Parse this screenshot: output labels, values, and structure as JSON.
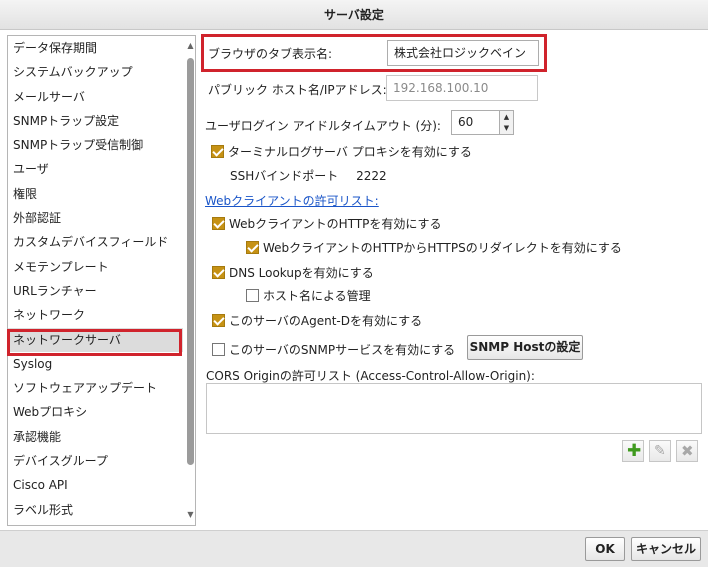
{
  "window": {
    "title": "サーバ設定"
  },
  "sidebar": {
    "items": [
      {
        "label": "データ保存期間"
      },
      {
        "label": "システムバックアップ"
      },
      {
        "label": "メールサーバ"
      },
      {
        "label": "SNMPトラップ設定"
      },
      {
        "label": "SNMPトラップ受信制御"
      },
      {
        "label": "ユーザ"
      },
      {
        "label": "権限"
      },
      {
        "label": "外部認証"
      },
      {
        "label": "カスタムデバイスフィールド"
      },
      {
        "label": "メモテンプレート"
      },
      {
        "label": "URLランチャー"
      },
      {
        "label": "ネットワーク"
      },
      {
        "label": "ネットワークサーバ"
      },
      {
        "label": "Syslog"
      },
      {
        "label": "ソフトウェアアップデート"
      },
      {
        "label": "Webプロキシ"
      },
      {
        "label": "承認機能"
      },
      {
        "label": "デバイスグループ"
      },
      {
        "label": "Cisco API"
      },
      {
        "label": "ラベル形式"
      }
    ],
    "selected": "ネットワークサーバ"
  },
  "form": {
    "tab_name_label": "ブラウザのタブ表示名:",
    "tab_name_value": "株式会社ロジックベイン",
    "public_host_label": "パブリック ホスト名/IPアドレス:",
    "public_host_placeholder": "192.168.100.10",
    "idle_timeout_label": "ユーザログイン アイドルタイムアウト (分):",
    "idle_timeout_value": "60",
    "terminal_proxy_label": "ターミナルログサーバ プロキシを有効にする",
    "ssh_port_label": "SSHバインドポート",
    "ssh_port_value": "2222",
    "web_allow_list_link": "Webクライアントの許可リスト:",
    "http_enable_label": "WebクライアントのHTTPを有効にする",
    "http_redirect_label": "WebクライアントのHTTPからHTTPSのリダイレクトを有効にする",
    "dns_lookup_label": "DNS Lookupを有効にする",
    "hostname_manage_label": "ホスト名による管理",
    "agent_d_label": "このサーバのAgent-Dを有効にする",
    "snmp_service_label": "このサーバのSNMPサービスを有効にする",
    "snmp_host_button": "SNMP Hostの設定",
    "cors_label": "CORS Originの許可リスト (Access-Control-Allow-Origin):"
  },
  "checkboxes": {
    "terminal_proxy": true,
    "http_enable": true,
    "http_redirect": true,
    "dns_lookup": true,
    "hostname_manage": false,
    "agent_d": true,
    "snmp_service": false
  },
  "footer": {
    "ok_label": "OK",
    "cancel_label": "キャンセル"
  },
  "colors": {
    "accent_check": "#c69214",
    "highlight": "#d0232c",
    "link": "#1a55c8"
  },
  "icons": {
    "add": "plus-icon",
    "edit": "pencil-icon",
    "delete": "x-icon"
  }
}
